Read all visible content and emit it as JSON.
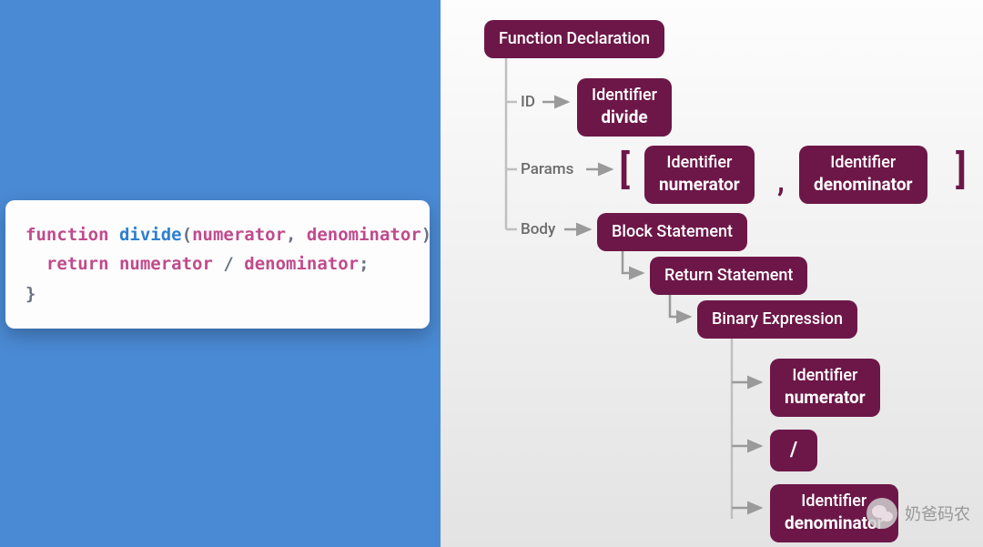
{
  "code": {
    "tokens": {
      "fn_keyword": "function",
      "fn_name": "divide",
      "paren_open": "(",
      "param1": "numerator",
      "comma": ",",
      "param2": "denominator",
      "paren_close": ")",
      "brace_open": "{",
      "return_kw": "return",
      "ident1": "numerator",
      "op": "/",
      "ident2": "denominator",
      "semicolon": ";",
      "brace_close": "}"
    }
  },
  "ast": {
    "root": "Function Declaration",
    "branches": {
      "id": {
        "label": "ID",
        "node": {
          "title": "Identifier",
          "sub": "divide"
        }
      },
      "params": {
        "label": "Params",
        "bracket_open": "[",
        "items": [
          {
            "title": "Identifier",
            "sub": "numerator"
          },
          {
            "title": "Identifier",
            "sub": "denominator"
          }
        ],
        "comma": ",",
        "bracket_close": "]"
      },
      "body": {
        "label": "Body",
        "chain": [
          "Block Statement",
          "Return Statement",
          "Binary Expression"
        ],
        "leaves": [
          {
            "title": "Identifier",
            "sub": "numerator"
          },
          {
            "title": "/",
            "sub": ""
          },
          {
            "title": "Identifier",
            "sub": "denominator"
          }
        ]
      }
    }
  },
  "watermark": {
    "text": "奶爸码农"
  }
}
